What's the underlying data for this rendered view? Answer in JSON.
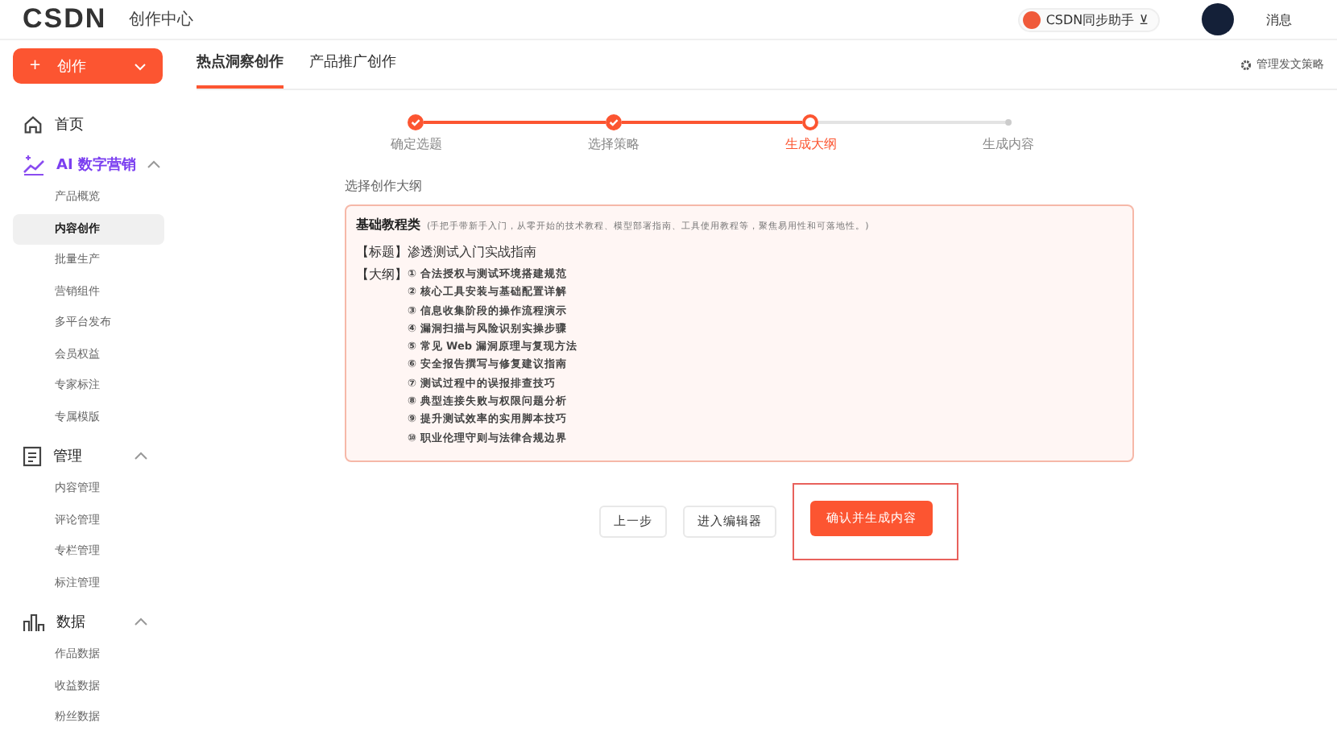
{
  "header": {
    "logo": "CSDN",
    "title": "创作中心",
    "assistant": "CSDN同步助手",
    "assistant_badge": "⊻",
    "messages": "消息"
  },
  "sidebar": {
    "create_icon": "+",
    "create_button": "创作",
    "groups": [
      {
        "label": "首页"
      },
      {
        "label": "AI 数字营销",
        "expanded": true,
        "items": [
          {
            "label": "产品概览",
            "selected": false
          },
          {
            "label": "内容创作",
            "selected": true
          },
          {
            "label": "批量生产",
            "selected": false
          },
          {
            "label": "营销组件",
            "selected": false
          },
          {
            "label": "多平台发布",
            "selected": false
          },
          {
            "label": "会员权益",
            "selected": false
          },
          {
            "label": "专家标注",
            "selected": false
          },
          {
            "label": "专属模版",
            "selected": false
          }
        ]
      },
      {
        "label": "管理",
        "expanded": true,
        "items": [
          {
            "label": "内容管理",
            "selected": false
          },
          {
            "label": "评论管理",
            "selected": false
          },
          {
            "label": "专栏管理",
            "selected": false
          },
          {
            "label": "标注管理",
            "selected": false
          }
        ]
      },
      {
        "label": "数据",
        "expanded": true,
        "items": [
          {
            "label": "作品数据",
            "selected": false
          },
          {
            "label": "收益数据",
            "selected": false
          },
          {
            "label": "粉丝数据",
            "selected": false
          }
        ]
      }
    ]
  },
  "tabs": [
    {
      "label": "热点洞察创作",
      "selected": true
    },
    {
      "label": "产品推广创作",
      "selected": false
    }
  ],
  "manage_link": "管理发文策略",
  "steps": [
    {
      "label": "确定选题",
      "completed": true,
      "selected": false
    },
    {
      "label": "选择策略",
      "completed": true,
      "selected": false
    },
    {
      "label": "生成大纲",
      "completed": false,
      "selected": true
    },
    {
      "label": "生成内容",
      "completed": false,
      "selected": false
    }
  ],
  "section_label": "选择创作大纲",
  "outline": {
    "category": "基础教程类",
    "description": "(手把手带新手入门，从零开始的技术教程、模型部署指南、工具使用教程等，聚焦易用性和可落地性。)",
    "title_label": "【标题】",
    "title": "渗透测试入门实战指南",
    "outline_label": "【大纲】",
    "items": [
      "① 合法授权与测试环境搭建规范",
      "② 核心工具安装与基础配置详解",
      "③ 信息收集阶段的操作流程演示",
      "④ 漏洞扫描与风险识别实操步骤",
      "⑤ 常见 Web 漏洞原理与复现方法",
      "⑥ 安全报告撰写与修复建议指南",
      "⑦ 测试过程中的误报排查技巧",
      "⑧ 典型连接失败与权限问题分析",
      "⑨ 提升测试效率的实用脚本技巧",
      "⑩ 职业伦理守则与法律合规边界"
    ]
  },
  "buttons": [
    {
      "label": "上一步",
      "kind": "plain",
      "highlighted": false
    },
    {
      "label": "进入编辑器",
      "kind": "plain",
      "highlighted": false
    },
    {
      "label": "确认并生成内容",
      "kind": "primary",
      "highlighted": true
    }
  ]
}
